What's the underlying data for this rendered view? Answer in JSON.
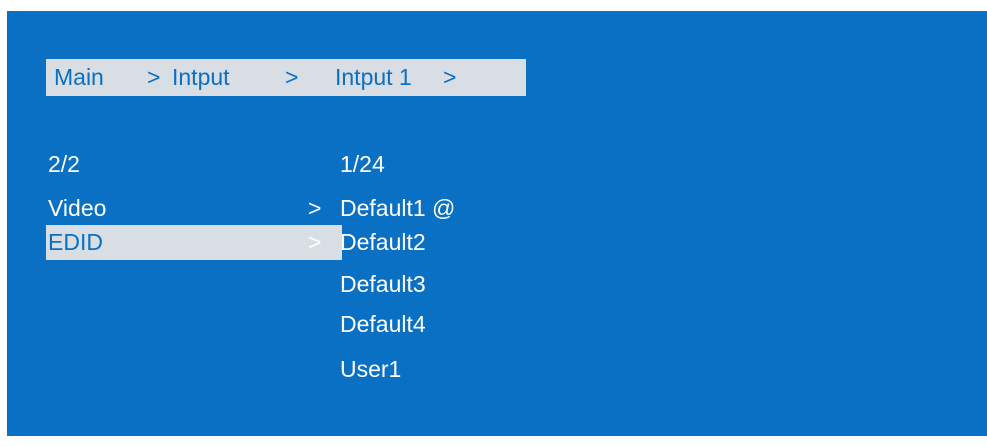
{
  "breadcrumb": {
    "main": "Main",
    "sep1": ">",
    "level1": "Intput",
    "sep2": ">",
    "level2": "Intput 1",
    "sep3": ">"
  },
  "left_menu": {
    "page": "2/2",
    "items": [
      {
        "label": "Video",
        "arrow": ">"
      },
      {
        "label": "EDID",
        "arrow": ">",
        "selected": true
      }
    ]
  },
  "right_menu": {
    "page": "1/24",
    "items": [
      {
        "label": "Default1 @"
      },
      {
        "label": "Default2"
      },
      {
        "label": "Default3"
      },
      {
        "label": "Default4"
      },
      {
        "label": "User1"
      }
    ]
  },
  "colors": {
    "screen_background": "#0a70c4",
    "highlight_background": "#d9dde4",
    "text": "#ffffff",
    "highlight_text": "#0a70c4"
  }
}
